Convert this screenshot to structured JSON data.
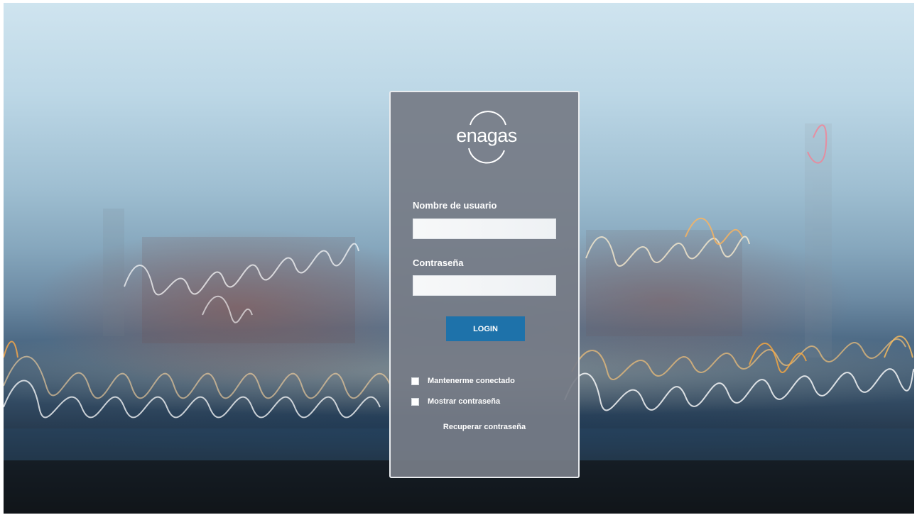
{
  "brand": {
    "logo_text": "enagas",
    "logo_color": "#ffffff"
  },
  "login": {
    "username_label": "Nombre de usuario",
    "username_value": "",
    "password_label": "Contraseña",
    "password_value": "",
    "login_button": "LOGIN",
    "remember_label": "Mantenerme conectado",
    "show_password_label": "Mostrar contraseña",
    "recover_link": "Recuperar contraseña",
    "button_color": "#1e72aa"
  }
}
